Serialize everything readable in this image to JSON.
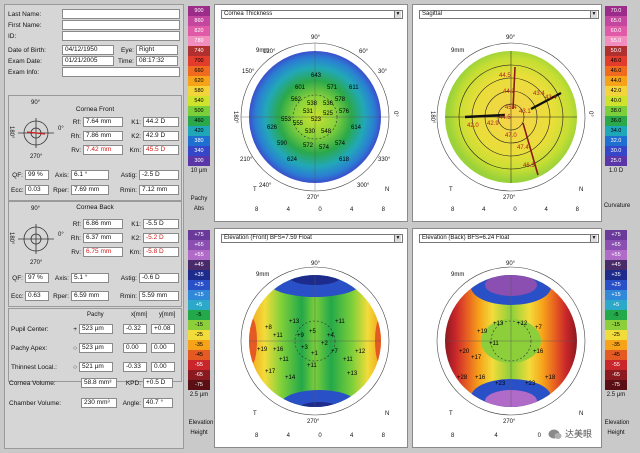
{
  "patient": {
    "last_name_label": "Last Name:",
    "first_name_label": "First Name:",
    "id_label": "ID:",
    "dob_label": "Date of Birth:",
    "dob": "04/12/1950",
    "eye_label": "Eye:",
    "eye": "Right",
    "exam_date_label": "Exam Date:",
    "exam_date": "01/21/2005",
    "time_label": "Time:",
    "time": "08:17:32",
    "exam_info_label": "Exam Info:"
  },
  "front": {
    "title": "Cornea Front",
    "rf_label": "Rf:",
    "rf": "7.64 mm",
    "k1_label": "K1:",
    "k1": "44.2 D",
    "rh_label": "Rh:",
    "rh": "7.86 mm",
    "k2_label": "K2:",
    "k2": "42.9 D",
    "rv_label": "Rv:",
    "rv": "7.42 mm",
    "km_label": "Km:",
    "km": "45.5 D",
    "qf_label": "QF:",
    "qf": "99 %",
    "axis_label": "Axis:",
    "axis": "6.1 °",
    "astig_label": "Astig:",
    "astig": "-2.5 D",
    "ecc_label": "Ecc:",
    "ecc": "0.03",
    "rper_label": "Rper:",
    "rper": "7.69 mm",
    "rmin_label": "Rmin:",
    "rmin": "7.12 mm"
  },
  "back": {
    "title": "Cornea Back",
    "rf_label": "Rf:",
    "rf": "6.86 mm",
    "k1_label": "K1:",
    "k1": "-5.5 D",
    "rh_label": "Rh:",
    "rh": "6.37 mm",
    "k2_label": "K2:",
    "k2": "-5.2 D",
    "rv_label": "Rv:",
    "rv": "6.75 mm",
    "km_label": "Km:",
    "km": "-5.8 D",
    "qf_label": "QF:",
    "qf": "97 %",
    "axis_label": "Axis:",
    "axis": "5.1 °",
    "astig_label": "Astig:",
    "astig": "-0.6 D",
    "ecc_label": "Ecc:",
    "ecc": "0.63",
    "rper_label": "Rper:",
    "rper": "6.59 mm",
    "rmin_label": "Rmin:",
    "rmin": "5.59 mm"
  },
  "dial": {
    "top": "90°",
    "bottom": "270°",
    "left": "180°",
    "right": "0°"
  },
  "pachy": {
    "col_pachy": "Pachy",
    "col_x": "x[mm]",
    "col_y": "y[mm]",
    "rows": [
      {
        "label": "Pupil Center:",
        "sym": "+",
        "pachy": "523 µm",
        "x": "-0.32",
        "y": "+0.08"
      },
      {
        "label": "Pachy Apex:",
        "sym": "○",
        "pachy": "523 µm",
        "x": "0.00",
        "y": "0.00"
      },
      {
        "label": "Thinnest Local.:",
        "sym": "○",
        "pachy": "521 µm",
        "x": "-0.33",
        "y": "0.00"
      }
    ],
    "cornea_volume_label": "Cornea Volume:",
    "cornea_volume": "58.8 mm³",
    "kpd_label": "KPD:",
    "kpd": "+0.5 D",
    "chamber_volume_label": "Chamber Volume:",
    "chamber_volume": "230 mm³",
    "angle_label": "Angle:",
    "angle": "40.7 °"
  },
  "maps": {
    "thickness": {
      "title": "Cornea Thickness",
      "values": [
        "643",
        "601",
        "571",
        "562",
        "538",
        "536",
        "578",
        "611",
        "531",
        "523",
        "525",
        "576",
        "553",
        "530",
        "555",
        "548",
        "626",
        "614",
        "590",
        "572",
        "574",
        "574",
        "624",
        "618"
      ]
    },
    "sagittal": {
      "title": "Sagittal",
      "values": [
        "44.5",
        "44.2",
        "43.4",
        "43.1",
        "42.9",
        "42.0",
        "45.4",
        "44.5",
        "47.0",
        "47.4",
        "46.3",
        "43.4"
      ]
    },
    "elev_front": {
      "title": "Elevation (Front)  BFS=7.59 Float",
      "values": [
        "+8",
        "+11",
        "+13",
        "+11",
        "+19",
        "+16",
        "+9",
        "+5",
        "+2",
        "+4",
        "+3",
        "+1",
        "+11",
        "+11",
        "+11",
        "+17",
        "+14",
        "+13",
        "+12",
        "+7"
      ]
    },
    "elev_back": {
      "title": "Elevation (Back)  BFS=6.24 Float",
      "values": [
        "+19",
        "+13",
        "+12",
        "+7",
        "+11",
        "+20",
        "+17",
        "+16",
        "+16",
        "+28",
        "+18",
        "+23",
        "+23"
      ]
    },
    "compass": {
      "n": "N",
      "t": "T"
    },
    "mm_label": "9mm",
    "angles_deg": {
      "a90": "90°",
      "a270": "270°",
      "a0": "0°",
      "a180": "180°",
      "a30": "30°",
      "a60": "60°",
      "a120": "120°",
      "a150": "150°",
      "a210": "210°",
      "a240": "240°",
      "a300": "300°",
      "a330": "330°"
    },
    "axis_ticks_x": [
      "8",
      "4",
      "0",
      "4",
      "8"
    ],
    "axis_ticks_y": [
      "8",
      "4",
      "0",
      "4",
      "8"
    ]
  },
  "scale_thickness": {
    "values": [
      "900",
      "860",
      "820",
      "780",
      "740",
      "700",
      "660",
      "620",
      "580",
      "540",
      "500",
      "460",
      "420",
      "380",
      "340",
      "300"
    ],
    "unit": "10 µm",
    "label1": "Pachy",
    "label2": "Abs"
  },
  "scale_curvature": {
    "values": [
      "70.0",
      "65.0",
      "60.0",
      "55.0",
      "50.0",
      "48.0",
      "46.0",
      "44.0",
      "42.0",
      "40.0",
      "38.0",
      "36.0",
      "34.0",
      "32.0",
      "30.0",
      "25.0"
    ],
    "unit": "1.0 D",
    "label1": "Curvature"
  },
  "scale_elev_left": {
    "values": [
      "+75",
      "+65",
      "+55",
      "+45",
      "+35",
      "+25",
      "+15",
      "+5",
      "-5",
      "-15",
      "-25",
      "-35",
      "-45",
      "-55",
      "-65",
      "-75"
    ],
    "unit": "2.5 µm",
    "label1": "Elevation",
    "label2": "Height"
  },
  "scale_elev_right": {
    "values": [
      "+75",
      "+65",
      "+55",
      "+45",
      "+35",
      "+25",
      "+15",
      "+5",
      "-5",
      "-15",
      "-25",
      "-35",
      "-45",
      "-55",
      "-65",
      "-75"
    ],
    "unit": "2.5 µm",
    "label1": "Elevation",
    "label2": "Height"
  },
  "watermark": "达美眼",
  "colors": {
    "scale_warm": [
      "#9c2c8a",
      "#c4479f",
      "#e05aa8",
      "#f08fbf",
      "#b03030",
      "#e23d2c",
      "#f06b1f",
      "#f7a31a",
      "#f3d43a",
      "#cfe22c",
      "#7ccf3a",
      "#2ba84a",
      "#1fa6b8",
      "#1f6fd0",
      "#3547c8",
      "#5a36a8"
    ],
    "scale_elev": [
      "#6a3a9a",
      "#8a4fb0",
      "#b06ac8",
      "#4a2b6a",
      "#1d2c8c",
      "#2a50c8",
      "#2f88d8",
      "#2ca8c8",
      "#23a84a",
      "#8ccf3a",
      "#f2dc3a",
      "#f7a31a",
      "#e55a22",
      "#c8262a",
      "#8a1a20",
      "#5a0f14"
    ]
  }
}
